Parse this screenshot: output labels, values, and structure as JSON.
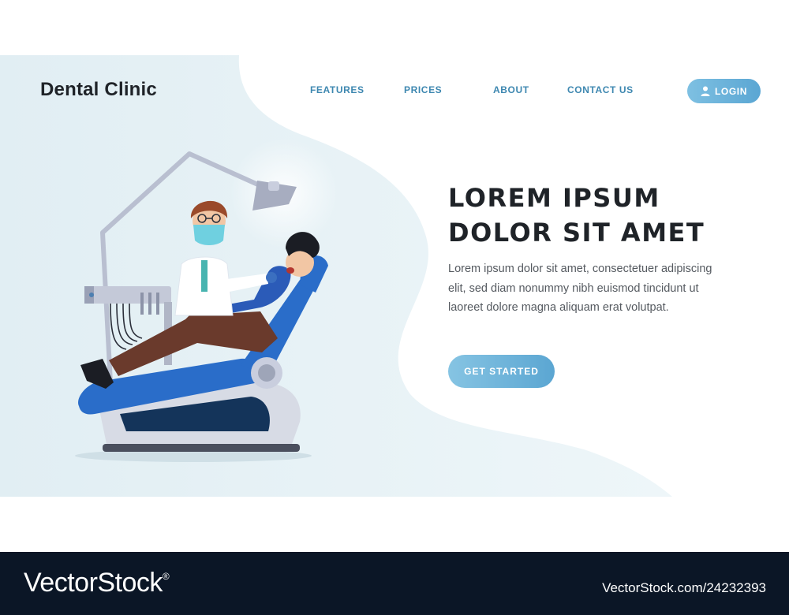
{
  "header": {
    "brand": "Dental Clinic",
    "nav": [
      {
        "label": "FEATURES"
      },
      {
        "label": "PRICES"
      },
      {
        "label": "ABOUT"
      },
      {
        "label": "CONTACT US"
      }
    ],
    "login_label": "LOGIN",
    "login_icon": "user-icon"
  },
  "hero": {
    "headline_line1": "LOREM IPSUM",
    "headline_line2": "DOLOR SIT AMET",
    "body": "Lorem ipsum dolor sit amet, consectetuer adipiscing elit, sed diam nonummy nibh euismod tincidunt ut laoreet dolore magna aliquam erat volutpat.",
    "cta_label": "GET STARTED"
  },
  "illustration": {
    "subject": "dentist-patient-chair-illustration"
  },
  "watermark": {
    "logo": "VectorStock",
    "logo_mark": "®",
    "url": "VectorStock.com/24232393"
  },
  "colors": {
    "accent": "#5aa6d3",
    "nav_text": "#3d87b0",
    "hero_bg": "#e6f2f6",
    "footer_bg": "#0b1626",
    "heading": "#1f2328"
  }
}
